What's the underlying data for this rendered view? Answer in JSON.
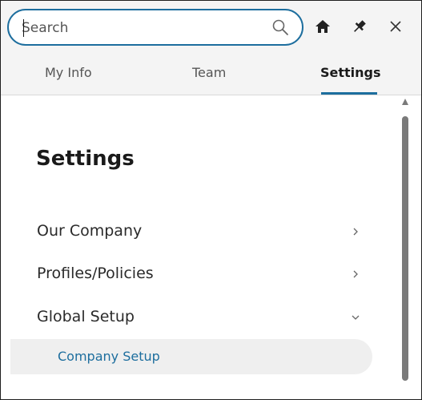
{
  "search": {
    "placeholder": "Search",
    "value": ""
  },
  "header": {
    "icons": [
      "home-icon",
      "pin-icon",
      "close-icon"
    ]
  },
  "tabs": [
    {
      "label": "My Info",
      "active": false
    },
    {
      "label": "Team",
      "active": false
    },
    {
      "label": "Settings",
      "active": true
    }
  ],
  "main": {
    "title": "Settings",
    "items": [
      {
        "label": "Our Company",
        "chevron": "chevron-right-icon"
      },
      {
        "label": "Profiles/Policies",
        "chevron": "chevron-right-icon"
      },
      {
        "label": "Global Setup",
        "chevron": "chevron-down-icon"
      }
    ],
    "subitems": [
      {
        "label": "Company Setup"
      }
    ]
  },
  "colors": {
    "accent": "#1d6e9e",
    "header_bg": "#f4f4f4",
    "selected_bg": "#efefef"
  }
}
